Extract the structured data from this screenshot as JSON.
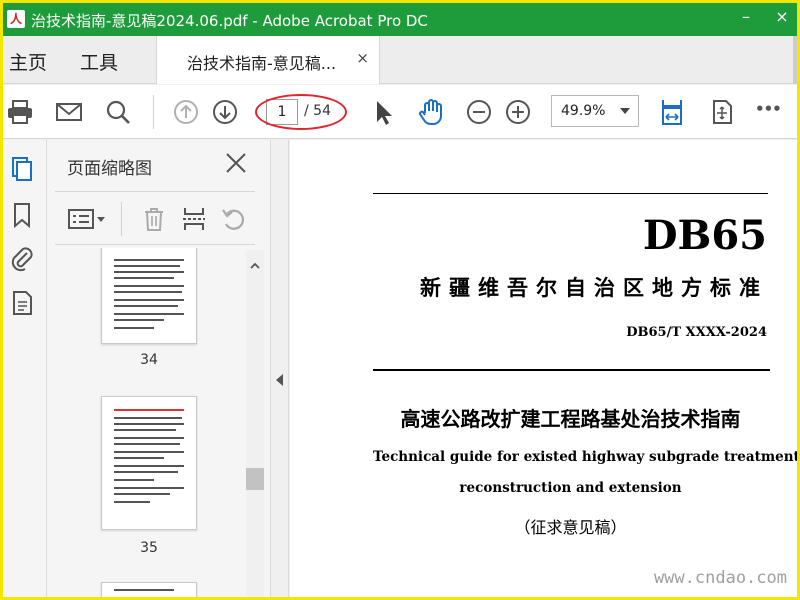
{
  "window": {
    "title": "治技术指南-意见稿2024.06.pdf - Adobe Acrobat Pro DC",
    "icon_glyph": "人",
    "controls": {
      "minimize": "–",
      "close": "×"
    }
  },
  "tabs": {
    "home": "主页",
    "tools": "工具",
    "document": "治技术指南-意见稿...",
    "close_glyph": "×"
  },
  "toolbar": {
    "page_current": "1",
    "page_total": "/ 54",
    "zoom": "49.9%",
    "more_glyph": "•••"
  },
  "thumbnail_panel": {
    "title": "页面缩略图",
    "pages": [
      {
        "label": "34"
      },
      {
        "label": "35"
      }
    ]
  },
  "document": {
    "code": "DB65",
    "standard_type": "新疆维吾尔自治区地方标准",
    "standard_number": "DB65/T  XXXX-2024",
    "title_cn": "高速公路改扩建工程路基处治技术指南",
    "title_en_line1": "Technical guide for existed highway subgrade treatment,",
    "title_en_line2": "reconstruction and extension",
    "draft_label": "（征求意见稿）"
  },
  "watermark": "www.cndao.com",
  "colors": {
    "titlebar": "#1e9c3c",
    "frame": "#f3e600",
    "accent_blue": "#1a6fc4",
    "annotation_red": "#e0252b"
  }
}
